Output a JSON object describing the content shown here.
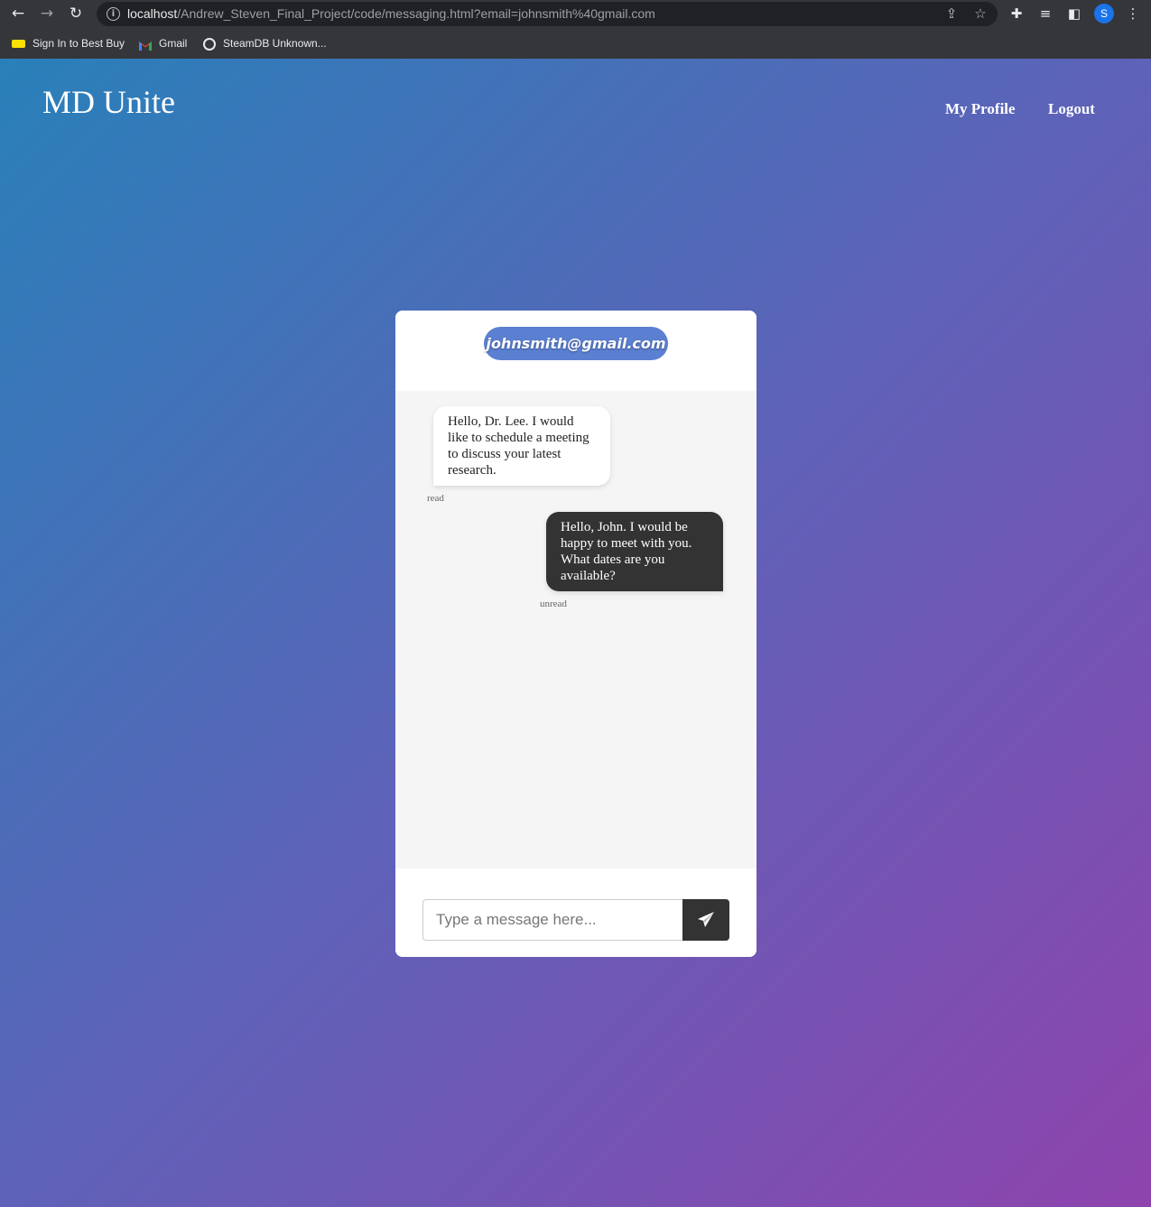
{
  "browser": {
    "url_host": "localhost",
    "url_path": "/Andrew_Steven_Final_Project/code/messaging.html?email=johnsmith%40gmail.com",
    "profile_initial": "S",
    "bookmarks": [
      {
        "label": "Sign In to Best Buy",
        "icon": "tag-icon"
      },
      {
        "label": "Gmail",
        "icon": "gmail-icon"
      },
      {
        "label": "SteamDB Unknown...",
        "icon": "steamdb-icon"
      }
    ]
  },
  "header": {
    "logo": "MD Unite",
    "nav": [
      {
        "label": "My Profile"
      },
      {
        "label": "Logout"
      }
    ]
  },
  "chat": {
    "recipient_email": "johnsmith@gmail.com",
    "messages": [
      {
        "direction": "incoming",
        "text": "Hello, Dr. Lee. I would like to schedule a meeting to discuss your latest research.",
        "status": "read"
      },
      {
        "direction": "outgoing",
        "text": "Hello, John. I would be happy to meet with you. What dates are you available?",
        "status": "unread"
      }
    ],
    "composer": {
      "placeholder": "Type a message here...",
      "value": "",
      "send_icon": "paper-plane-icon"
    }
  },
  "colors": {
    "gradient_start": "#2980b9",
    "gradient_end": "#8e44ad",
    "email_pill": "#5b7fd1",
    "outgoing_bubble": "#333333",
    "send_button": "#333333"
  }
}
